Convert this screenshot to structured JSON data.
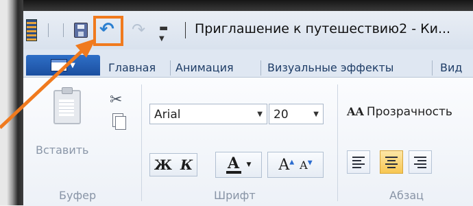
{
  "window": {
    "title": "Приглашение к путешествию2 - Ки..."
  },
  "quick_access": {
    "items": [
      "app-icon",
      "save-icon",
      "undo-icon",
      "redo-icon",
      "customize-dropdown"
    ],
    "highlighted": "undo-icon",
    "highlight_color": "#f07a1e"
  },
  "tabs": {
    "file_tab_icon": "file-menu-icon",
    "items": [
      {
        "label": "Главная"
      },
      {
        "label": "Анимация"
      },
      {
        "label": "Визуальные эффекты"
      },
      {
        "label": "Вид"
      }
    ]
  },
  "ribbon": {
    "clipboard": {
      "paste_label": "Вставить",
      "group_label": "Буфер"
    },
    "font": {
      "font_family": "Arial",
      "font_size": "20",
      "bold_label": "Ж",
      "italic_label": "К",
      "color_label": "A",
      "grow_label": "A",
      "shrink_label": "A",
      "group_label": "Шрифт"
    },
    "paragraph": {
      "transparency_label": "Прозрачность",
      "transparency_icon_text": "AA",
      "group_label": "Абзац",
      "active_alignment": "center"
    }
  },
  "colors": {
    "accent_annotation": "#f07a1e",
    "file_tab": "#1f5aa8",
    "active_button": "#f7c752"
  }
}
